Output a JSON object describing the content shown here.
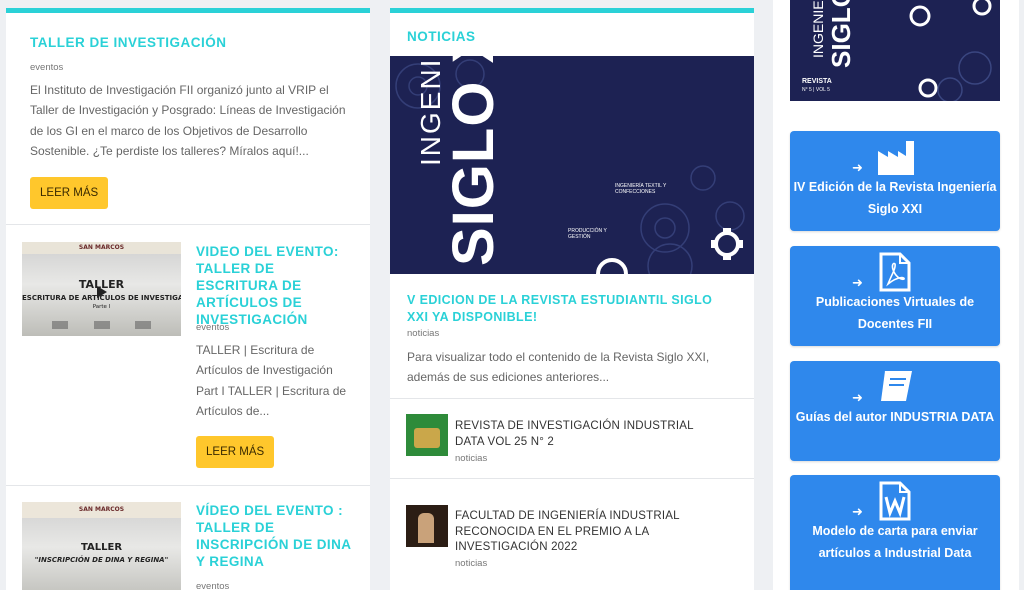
{
  "left": {
    "taller": {
      "title": "TALLER DE INVESTIGACIÓN",
      "tag": "eventos",
      "excerpt": "El Instituto de Investigación FII organizó junto al VRIP el Taller de Investigación y Posgrado: Líneas de Investigación de los GI en el marco de los Objetivos de Desarrollo Sostenible. ¿Te perdiste los talleres? Míralos aquí!...",
      "button": "LEER MÁS"
    },
    "video1": {
      "title": "VIDEO DEL EVENTO: TALLER DE ESCRITURA DE ARTÍCULOS DE INVESTIGACIÓN",
      "tag": "eventos",
      "excerpt": "TALLER | Escritura de Artículos de Investigación Part I TALLER | Escritura de Artículos de...",
      "button": "LEER MÁS",
      "thumb_header": "SAN MARCOS",
      "thumb_line1": "TALLER",
      "thumb_line2": "ESCRITURA DE ARTÍCULOS DE INVESTIGACIÓN",
      "thumb_line3": "Parte I"
    },
    "video2": {
      "title": "VÍDEO DEL EVENTO : TALLER DE INSCRIPCIÓN DE DINA Y REGINA",
      "tag": "eventos",
      "thumb_header": "SAN MARCOS",
      "thumb_line1": "TALLER",
      "thumb_line2": "\"INSCRIPCIÓN DE DINA Y REGINA\""
    }
  },
  "middle": {
    "section": "NOTICIAS",
    "hero": {
      "vertical_text_1": "INGENIERÍA",
      "vertical_text_2": "SIGLO XXI",
      "label_a": "INGENIERÍA TEXTIL Y CONFECCIONES",
      "label_b": "PRODUCCIÓN Y GESTIÓN"
    },
    "featured": {
      "title": "V EDICION DE LA REVISTA ESTUDIANTIL SIGLO XXI YA DISPONIBLE!",
      "tag": "noticias",
      "excerpt": "Para visualizar todo el contenido de la Revista Siglo XXI, además de sus ediciones anteriores..."
    },
    "items": [
      {
        "title": "REVISTA DE INVESTIGACIÓN INDUSTRIAL DATA VOL 25 N° 2",
        "tag": "noticias"
      },
      {
        "title": "FACULTAD DE INGENIERÍA INDUSTRIAL RECONOCIDA EN EL PREMIO A LA INVESTIGACIÓN 2022",
        "tag": "noticias"
      }
    ]
  },
  "right": {
    "cover": {
      "text_1": "INGENIERÍA",
      "text_2": "SIGLO",
      "text_3": "REVISTA",
      "text_4": "N° 5 | VOL 5"
    },
    "buttons": [
      {
        "label": "IV Edición de la Revista Ingeniería Siglo XXI",
        "icon": "factory-icon"
      },
      {
        "label": "Publicaciones Virtuales de Docentes FII",
        "icon": "pdf-file-icon"
      },
      {
        "label": "Guías del autor INDUSTRIA DATA",
        "icon": "book-icon"
      },
      {
        "label": "Modelo de carta para enviar artículos a Industrial Data",
        "icon": "word-file-icon"
      }
    ],
    "arrow": "➜"
  },
  "colors": {
    "accent": "#2ad1d7",
    "yellow": "#ffc72c",
    "blue": "#2f88ec",
    "navy": "#1d2253"
  }
}
